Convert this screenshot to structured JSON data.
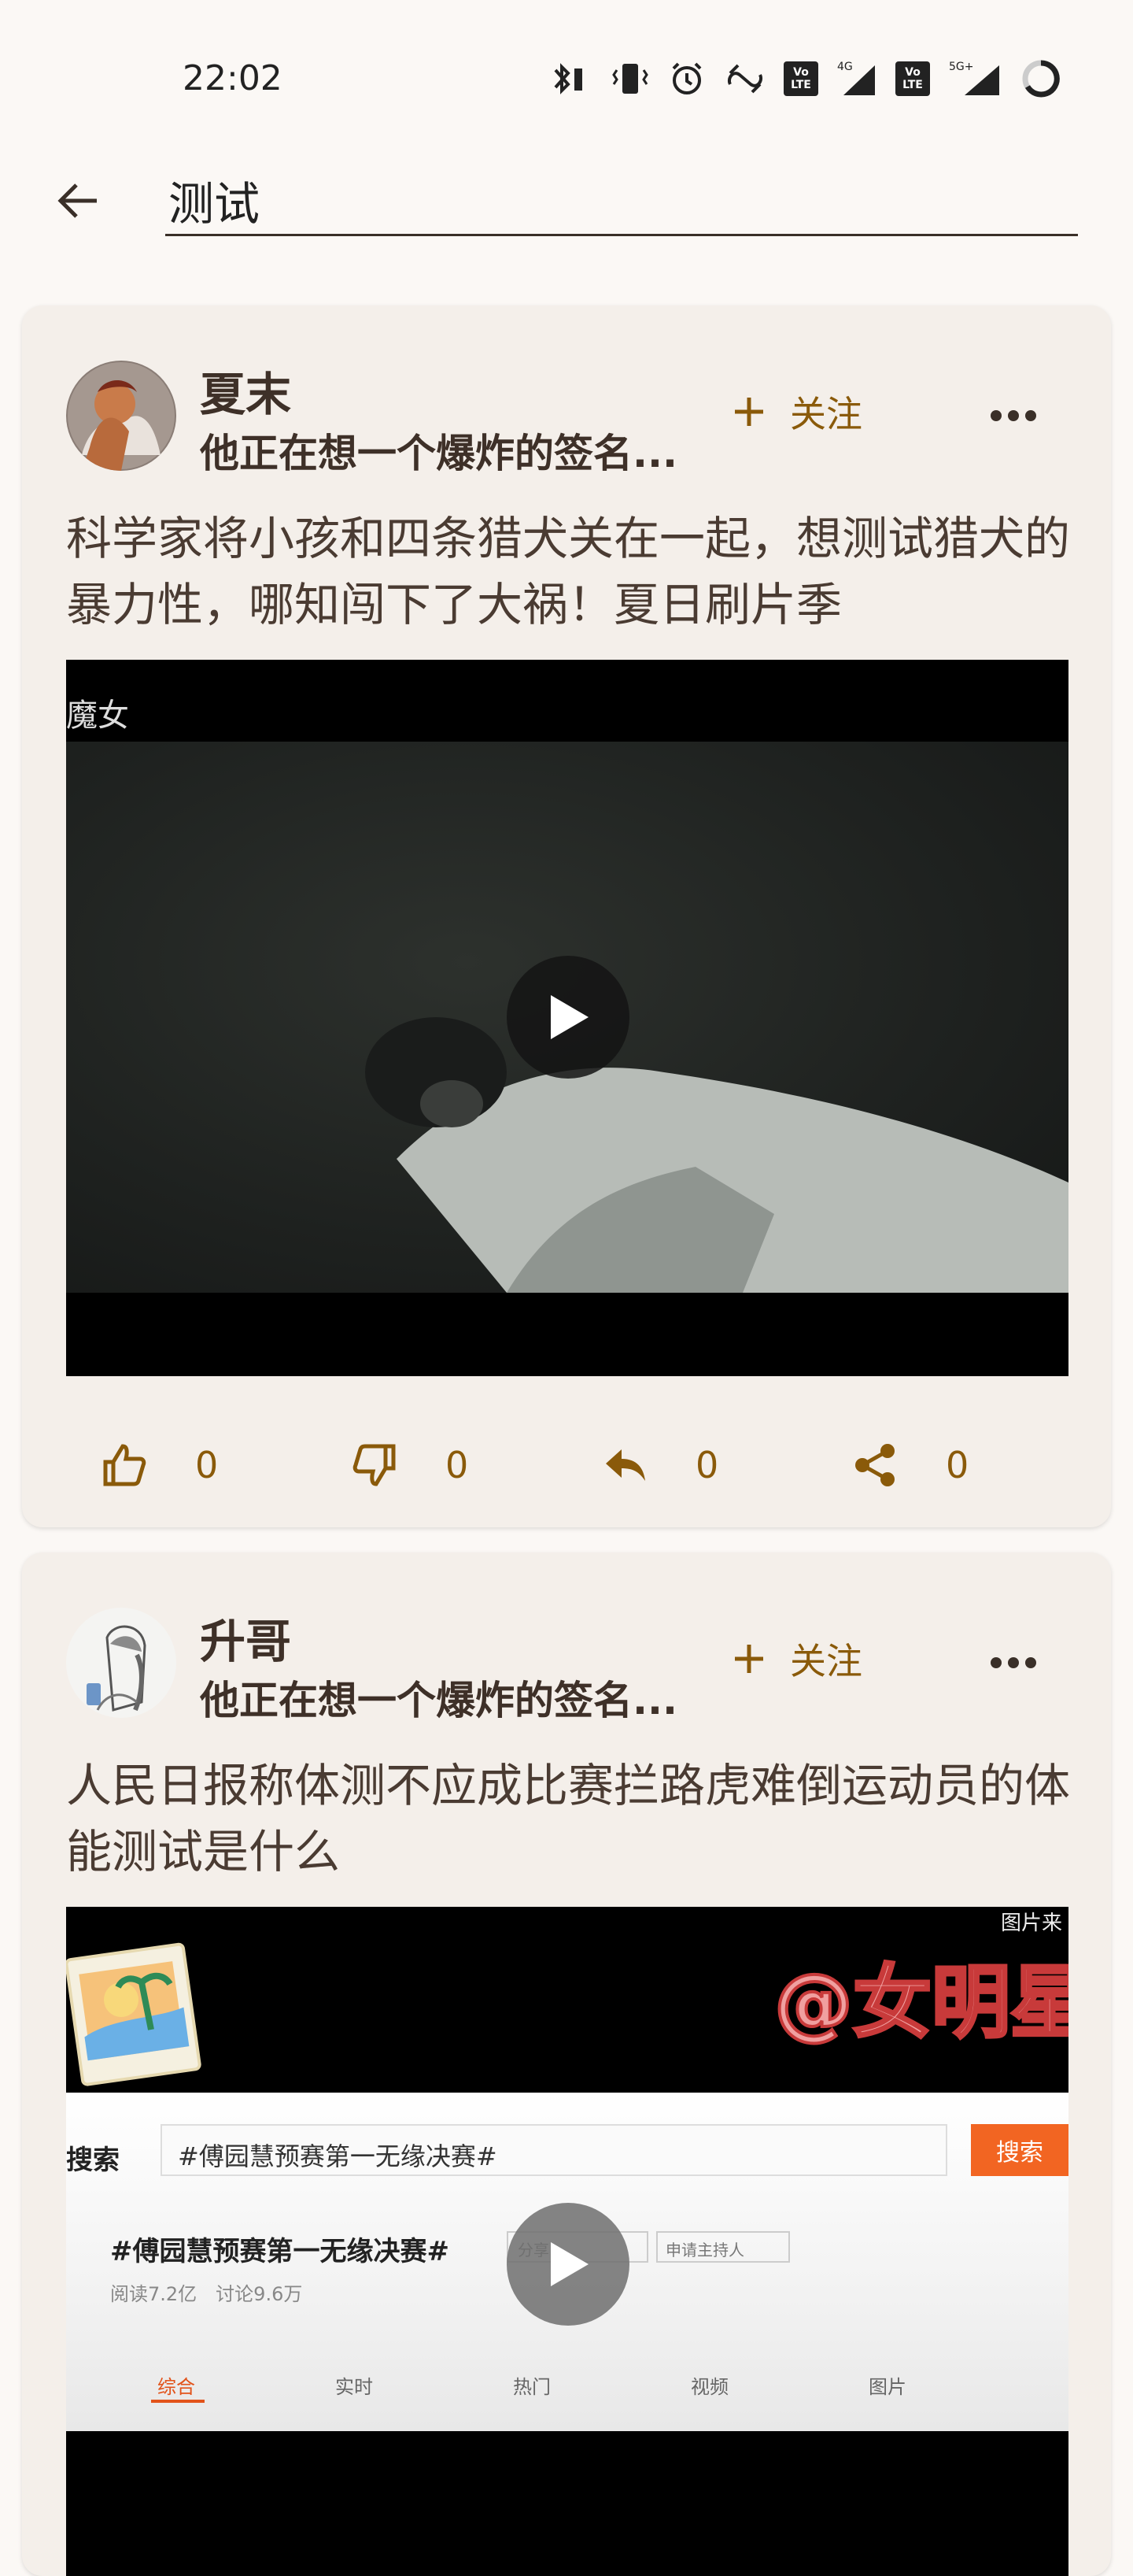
{
  "status_bar": {
    "time": "22:02",
    "icons": [
      "bluetooth-icon",
      "vibrate-icon",
      "alarm-icon",
      "link-icon",
      "volte-lte-icon",
      "signal-4g-icon",
      "volte-lte-icon",
      "signal-5g-icon",
      "battery-ring-icon"
    ],
    "net1": "4G",
    "net2": "5G+",
    "volte_top": "Vo",
    "volte_bottom": "LTE"
  },
  "search": {
    "query": "测试"
  },
  "colors": {
    "accent": "#8a5a0a",
    "card_bg": "#f4efea",
    "page_bg": "#fbf8f5",
    "text": "#3e3028"
  },
  "posts": [
    {
      "author": "夏末",
      "signature": "他正在想一个爆炸的签名...",
      "follow_label": "关注",
      "title": "科学家将小孩和四条猎犬关在一起，想测试猎犬的暴力性，哪知闯下了大祸！夏日刷片季",
      "video_caption": "魔女",
      "likes": "0",
      "dislikes": "0",
      "replies": "0",
      "shares": "0"
    },
    {
      "author": "升哥",
      "signature": "他正在想一个爆炸的签名...",
      "follow_label": "关注",
      "title": "人民日报称体测不应成比赛拦路虎难倒运动员的体能测试是什么",
      "video": {
        "badge": "图片来",
        "overlay_text": "@女明星",
        "search_label": "搜索",
        "search_query": "#傅园慧预赛第一无缘决赛#",
        "search_button": "搜索",
        "topic": "#傅园慧预赛第一无缘决赛#",
        "reads": "阅读7.2亿",
        "discussions": "讨论9.6万",
        "share": "分享",
        "host": "申请主持人",
        "tabs": [
          "综合",
          "实时",
          "热门",
          "视频",
          "图片"
        ]
      }
    }
  ]
}
